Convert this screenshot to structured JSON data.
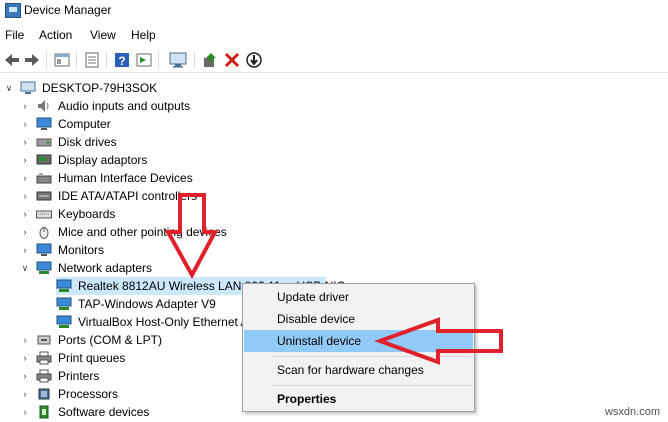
{
  "window": {
    "title": "Device Manager"
  },
  "menu": [
    "File",
    "Action",
    "View",
    "Help"
  ],
  "toolbar": {
    "buttons": [
      "back-arrow-icon",
      "forward-arrow-icon",
      "properties-icon",
      "list-icon",
      "help-icon",
      "view-icon",
      "monitor-icon",
      "update-driver-icon",
      "uninstall-icon",
      "download-icon"
    ],
    "colors": {
      "uninstall": "#d11a1a",
      "update": "#2a8a2a",
      "help": "#2b5fb8"
    }
  },
  "tree": {
    "root": "DESKTOP-79H3SOK",
    "categories": [
      {
        "label": "Audio inputs and outputs",
        "icon": "speaker-icon"
      },
      {
        "label": "Computer",
        "icon": "computer-icon"
      },
      {
        "label": "Disk drives",
        "icon": "disk-icon"
      },
      {
        "label": "Display adaptors",
        "icon": "display-icon"
      },
      {
        "label": "Human Interface Devices",
        "icon": "hid-icon"
      },
      {
        "label": "IDE ATA/ATAPI controllers",
        "icon": "ide-icon"
      },
      {
        "label": "Keyboards",
        "icon": "keyboard-icon"
      },
      {
        "label": "Mice and other pointing devices",
        "icon": "mouse-icon"
      },
      {
        "label": "Monitors",
        "icon": "monitor-icon"
      },
      {
        "label": "Network adapters",
        "icon": "network-icon"
      },
      {
        "label": "Ports (COM & LPT)",
        "icon": "port-icon"
      },
      {
        "label": "Print queues",
        "icon": "printer-icon"
      },
      {
        "label": "Printers",
        "icon": "printer-icon"
      },
      {
        "label": "Processors",
        "icon": "cpu-icon"
      },
      {
        "label": "Software devices",
        "icon": "software-icon"
      }
    ],
    "network_children": [
      "Realtek 8812AU Wireless LAN 802.11ac USB NIC",
      "TAP-Windows Adapter V9",
      "VirtualBox Host-Only Ethernet Adapter"
    ]
  },
  "context_menu": {
    "items": [
      "Update driver",
      "Disable device",
      "Uninstall device",
      "Scan for hardware changes",
      "Properties"
    ],
    "highlight": "#91c9f7"
  },
  "annotation": {
    "arrow_color": "#e0202a"
  },
  "watermark": "wsxdn.com"
}
